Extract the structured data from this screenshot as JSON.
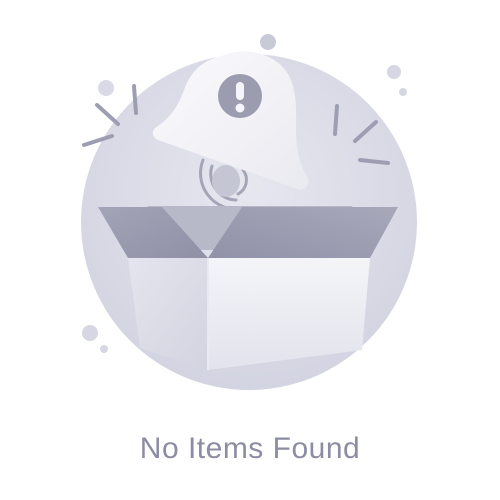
{
  "empty_state": {
    "message": "No Items Found",
    "icon": "empty-box-with-alert-bell-icon",
    "colors": {
      "text": "#8c8ca3",
      "circle": "#dcdde8",
      "bell": "#f4f4f8",
      "alert_badge": "#9b9cb0",
      "box_front": "#eceef4",
      "box_inside": "#9fa0b3",
      "accent_lines": "#9d9eb2",
      "dots": "#d6d7e3"
    }
  }
}
